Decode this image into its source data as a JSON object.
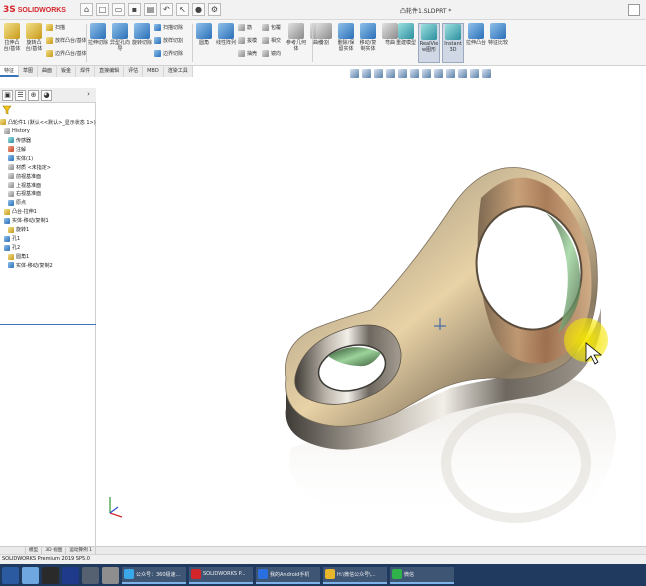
{
  "window": {
    "app_logo": "SOLIDWORKS",
    "doc_title": "凸轮件1.SLDPRT *"
  },
  "ribbon": {
    "groups": [
      {
        "label": "拉伸凸台/基体",
        "icon": "extrude-boss-icon"
      },
      {
        "label": "旋转凸台/基体",
        "icon": "revolve-boss-icon"
      },
      {
        "label": "扫描",
        "icon": "sweep-icon"
      },
      {
        "label": "放样凸台/基体",
        "icon": "loft-icon"
      },
      {
        "label": "边界凸台/基体",
        "icon": "boundary-boss-icon"
      },
      {
        "label": "拉伸切除",
        "icon": "extrude-cut-icon"
      },
      {
        "label": "异型孔向导",
        "icon": "hole-wizard-icon"
      },
      {
        "label": "旋转切除",
        "icon": "revolve-cut-icon"
      },
      {
        "label": "扫描切除",
        "icon": "sweep-cut-icon"
      },
      {
        "label": "放样切割",
        "icon": "loft-cut-icon"
      },
      {
        "label": "边界切除",
        "icon": "boundary-cut-icon"
      },
      {
        "label": "圆角",
        "icon": "fillet-icon"
      },
      {
        "label": "线性阵列",
        "icon": "linear-pattern-icon"
      },
      {
        "label": "筋",
        "icon": "rib-icon"
      },
      {
        "label": "拔模",
        "icon": "draft-icon"
      },
      {
        "label": "抽壳",
        "icon": "shell-icon"
      },
      {
        "label": "包覆",
        "icon": "wrap-icon"
      },
      {
        "label": "相交",
        "icon": "intersect-icon"
      },
      {
        "label": "镜向",
        "icon": "mirror-icon"
      },
      {
        "label": "参考几何体",
        "icon": "reference-geometry-icon"
      },
      {
        "label": "曲线",
        "icon": "curves-icon"
      },
      {
        "label": "3D纹理",
        "icon": "3d-texture-icon"
      },
      {
        "label": "分割",
        "icon": "split-icon"
      },
      {
        "label": "删除/保留实体",
        "icon": "delete-keep-body-icon"
      },
      {
        "label": "移动/复制实体",
        "icon": "move-copy-body-icon"
      },
      {
        "label": "弯曲",
        "icon": "flex-icon"
      },
      {
        "label": "包覆",
        "icon": "wrap-icon"
      },
      {
        "label": "重建模型",
        "icon": "rebuild-icon"
      },
      {
        "label": "RealView图形",
        "icon": "realview-icon"
      },
      {
        "label": "Instant3D",
        "icon": "instant3d-icon"
      },
      {
        "label": "拉伸凸台",
        "icon": "extrude-icon"
      },
      {
        "label": "特征比较",
        "icon": "compare-icon"
      }
    ]
  },
  "tabs": [
    "特征",
    "草图",
    "曲面",
    "钣金",
    "焊件",
    "直接编辑",
    "评估",
    "MBD",
    "渲染工具"
  ],
  "panel": {
    "root": "凸轮件1 (默认<<默认>_显示状态 1>)",
    "items": [
      {
        "label": "History",
        "icon": "history-icon"
      },
      {
        "label": "传感器",
        "icon": "sensor-icon"
      },
      {
        "label": "注解",
        "icon": "annotation-icon"
      },
      {
        "label": "实体(1)",
        "icon": "solid-bodies-icon"
      },
      {
        "label": "材质 <未指定>",
        "icon": "material-icon"
      },
      {
        "label": "前视基准面",
        "icon": "plane-icon"
      },
      {
        "label": "上视基准面",
        "icon": "plane-icon"
      },
      {
        "label": "右视基准面",
        "icon": "plane-icon"
      },
      {
        "label": "原点",
        "icon": "origin-icon"
      },
      {
        "label": "凸台-拉伸1",
        "icon": "extrude-feature-icon"
      },
      {
        "label": "实体-移动/复制1",
        "icon": "move-body-icon"
      },
      {
        "label": "旋转1",
        "icon": "revolve-feature-icon"
      },
      {
        "label": "孔1",
        "icon": "hole-feature-icon"
      },
      {
        "label": "孔2",
        "icon": "hole-feature-icon"
      },
      {
        "label": "圆角1",
        "icon": "fillet-feature-icon"
      },
      {
        "label": "实体-移动/复制2",
        "icon": "move-body-icon"
      }
    ]
  },
  "model_tabs": [
    "模型",
    "3D 视图",
    "运动算例 1"
  ],
  "status": {
    "text": "SOLIDWORKS Premium 2019 SP5.0"
  },
  "taskbar": {
    "apps": [
      {
        "label": "公众号：360极速...",
        "icon": "browser-icon",
        "color": "#3aa7e8"
      },
      {
        "label": "SOLIDWORKS P...",
        "icon": "solidworks-icon",
        "color": "#d4252b"
      },
      {
        "label": "我的Android手机",
        "icon": "phone-icon",
        "color": "#2a6fe0"
      },
      {
        "label": "H:\\微信公众号\\...",
        "icon": "folder-icon",
        "color": "#e8b62a"
      },
      {
        "label": "微信",
        "icon": "wechat-icon",
        "color": "#2fb24a"
      }
    ]
  },
  "colors": {
    "accent": "#3a74b8",
    "taskbar": "#1f3a5e",
    "logo": "#d4252b",
    "cursor_highlight": "#f5e600"
  }
}
